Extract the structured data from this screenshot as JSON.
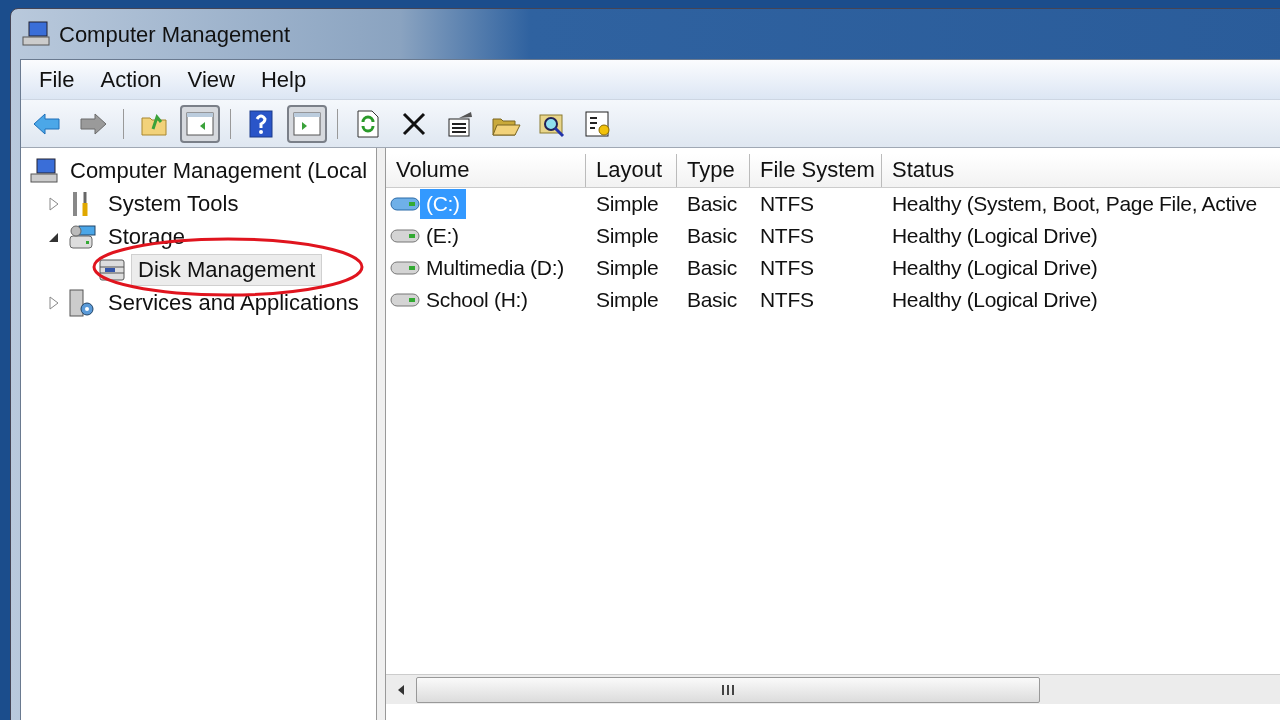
{
  "window": {
    "title": "Computer Management"
  },
  "menu": [
    "File",
    "Action",
    "View",
    "Help"
  ],
  "toolbar": [
    [
      {
        "kind": "back",
        "pressed": false
      },
      {
        "kind": "forward",
        "pressed": false
      }
    ],
    [
      {
        "kind": "up",
        "pressed": false
      },
      {
        "kind": "tree",
        "pressed": true
      }
    ],
    [
      {
        "kind": "help",
        "pressed": false
      },
      {
        "kind": "actionpane",
        "pressed": true
      }
    ],
    [
      {
        "kind": "refresh",
        "pressed": false
      },
      {
        "kind": "delete",
        "pressed": false
      },
      {
        "kind": "properties",
        "pressed": false
      },
      {
        "kind": "open",
        "pressed": false
      },
      {
        "kind": "find",
        "pressed": false
      },
      {
        "kind": "settings",
        "pressed": false
      }
    ]
  ],
  "tree": [
    {
      "label": "Computer Management (Local",
      "kind": "computer",
      "selected": false,
      "children": [
        {
          "label": "System Tools",
          "kind": "tools",
          "selected": false,
          "expanded": false
        },
        {
          "label": "Storage",
          "kind": "storage",
          "selected": false,
          "expanded": true,
          "children": [
            {
              "label": "Disk Management",
              "kind": "disk",
              "selected": true
            }
          ]
        },
        {
          "label": "Services and Applications",
          "kind": "services",
          "selected": false,
          "expanded": false
        }
      ]
    }
  ],
  "table": {
    "columns": [
      "Volume",
      "Layout",
      "Type",
      "File System",
      "Status"
    ],
    "rows": [
      {
        "cells": [
          "(C:)",
          "Simple",
          "Basic",
          "NTFS",
          "Healthy (System, Boot, Page File, Active"
        ],
        "selected": true,
        "system": true
      },
      {
        "cells": [
          "(E:)",
          "Simple",
          "Basic",
          "NTFS",
          "Healthy (Logical Drive)"
        ],
        "selected": false,
        "system": false
      },
      {
        "cells": [
          "Multimedia (D:)",
          "Simple",
          "Basic",
          "NTFS",
          "Healthy (Logical Drive)"
        ],
        "selected": false,
        "system": false
      },
      {
        "cells": [
          "School (H:)",
          "Simple",
          "Basic",
          "NTFS",
          "Healthy (Logical Drive)"
        ],
        "selected": false,
        "system": false
      }
    ]
  }
}
